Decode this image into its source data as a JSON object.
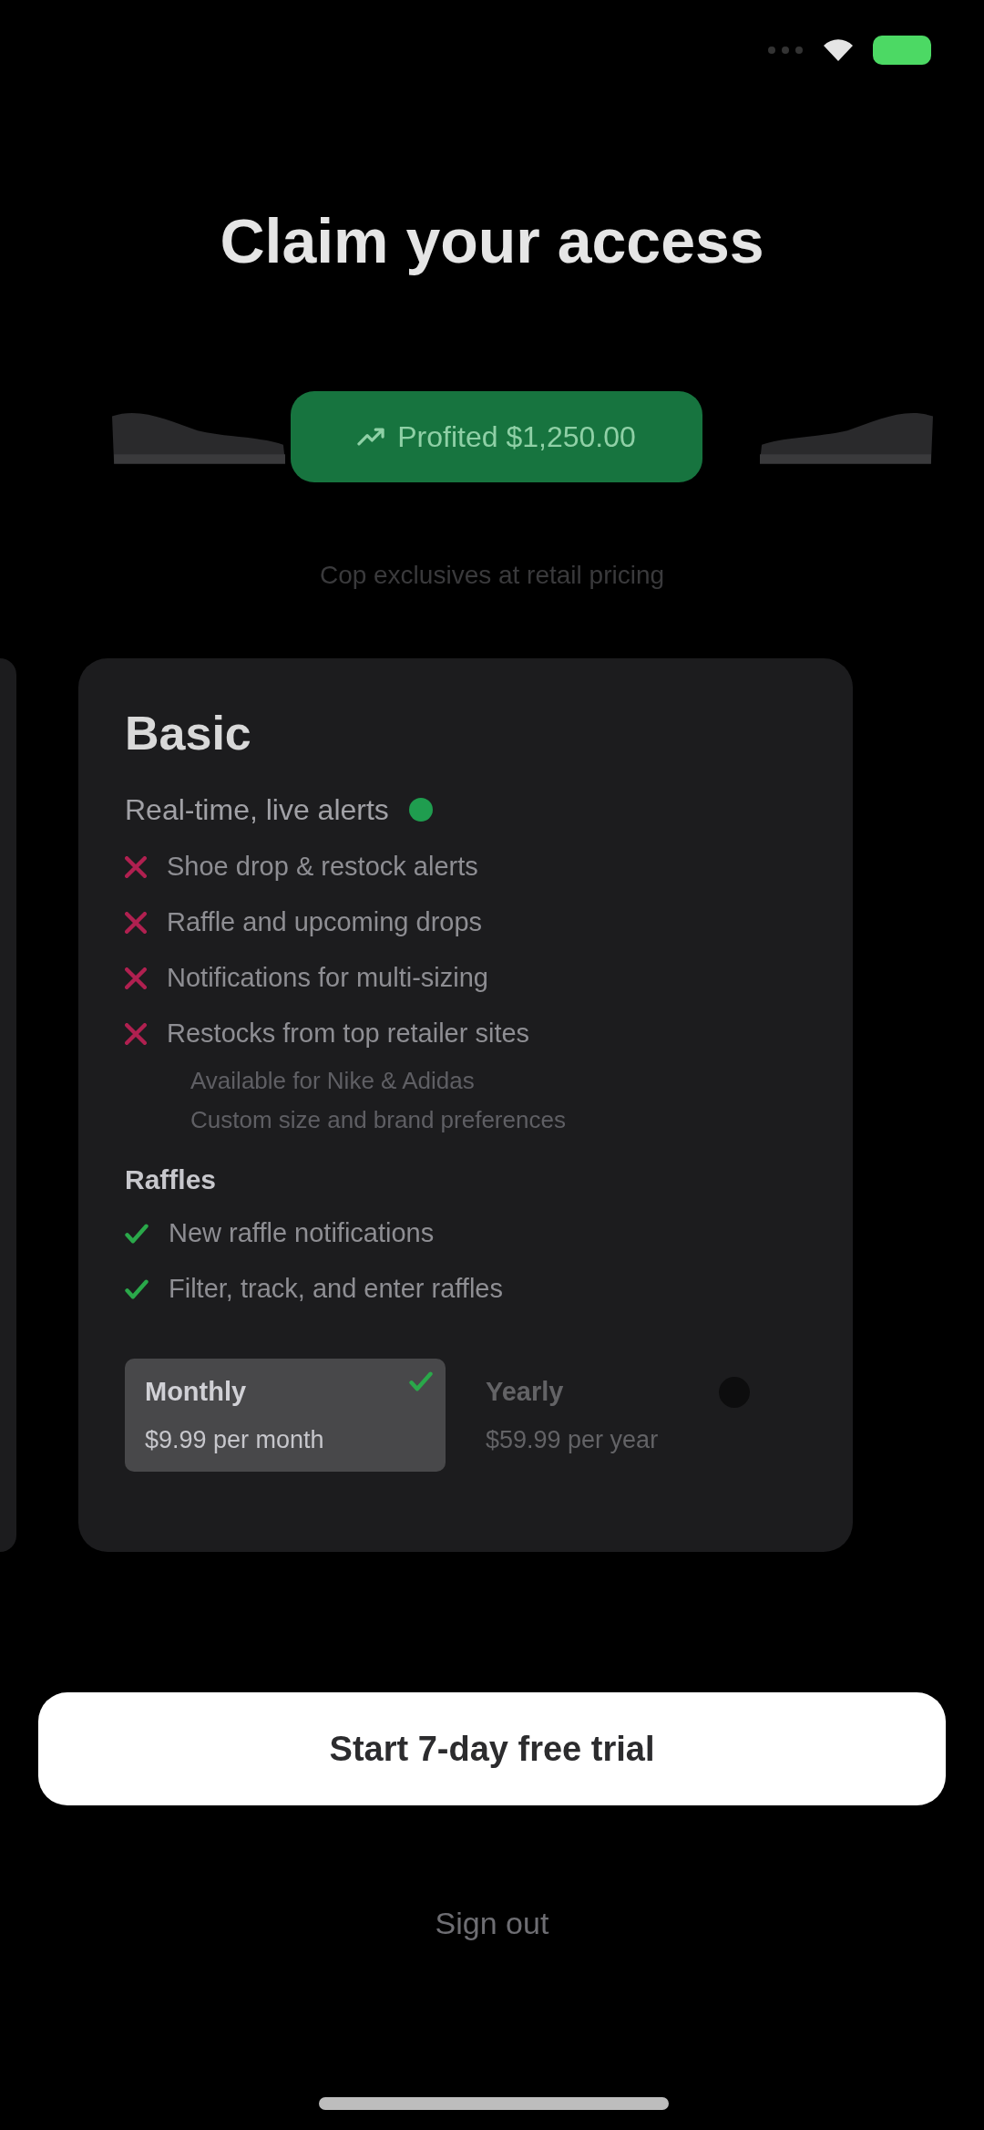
{
  "title": "Claim your access",
  "carousel": {
    "highlight": "Profited $1,250.00"
  },
  "caption": "Cop exclusives at retail pricing",
  "plan": {
    "name": "Basic",
    "tagline": "Real-time, live alerts",
    "features": [
      {
        "text": "Shoe drop & restock alerts",
        "included": false
      },
      {
        "text": "Raffle and upcoming drops",
        "included": false
      },
      {
        "text": "Notifications for multi-sizing",
        "included": false
      },
      {
        "text": "Restocks from top retailer sites",
        "included": false,
        "notes": [
          "Available for Nike & Adidas",
          "Custom size and brand preferences"
        ]
      }
    ],
    "sections": [
      {
        "heading": "Raffles",
        "features": [
          {
            "text": "New raffle notifications",
            "included": true
          },
          {
            "text": "Filter, track, and enter raffles",
            "included": true
          }
        ]
      }
    ],
    "billing_options": [
      {
        "label": "Monthly",
        "price": "$9.99 per month",
        "selected": true
      },
      {
        "label": "Yearly",
        "price": "$59.99 per year",
        "selected": false
      }
    ]
  },
  "primary_button": "Start 7-day free trial",
  "secondary_button": "Sign out"
}
